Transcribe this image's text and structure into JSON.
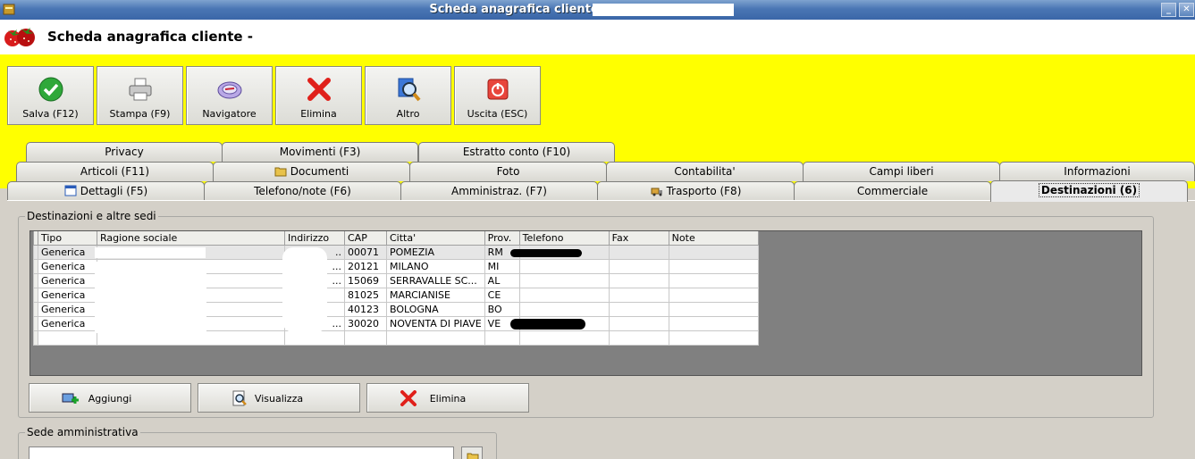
{
  "window": {
    "title": "Scheda anagrafica cliente -"
  },
  "header": {
    "title": "Scheda anagrafica cliente -"
  },
  "toolbar": [
    {
      "label": "Salva (F12)",
      "icon": "check-icon"
    },
    {
      "label": "Stampa (F9)",
      "icon": "printer-icon"
    },
    {
      "label": "Navigatore",
      "icon": "compass-icon"
    },
    {
      "label": "Elimina",
      "icon": "delete-x-icon"
    },
    {
      "label": "Altro",
      "icon": "magnifier-icon"
    },
    {
      "label": "Uscita (ESC)",
      "icon": "power-icon"
    }
  ],
  "tabs": {
    "row1": [
      "Privacy",
      "Movimenti (F3)",
      "Estratto conto (F10)"
    ],
    "row2": [
      "Articoli (F11)",
      "Documenti",
      "Foto",
      "Contabilita'",
      "Campi liberi",
      "Informazioni"
    ],
    "row3": [
      "Dettagli (F5)",
      "Telefono/note (F6)",
      "Amministraz. (F7)",
      "Trasporto (F8)",
      "Commerciale",
      "Destinazioni (6)"
    ]
  },
  "destinations": {
    "legend": "Destinazioni e altre sedi",
    "columns": [
      "Tipo",
      "Ragione sociale",
      "Indirizzo",
      "CAP",
      "Citta'",
      "Prov.",
      "Telefono",
      "Fax",
      "Note"
    ],
    "rows": [
      {
        "tipo": "Generica",
        "indirizzo": "..",
        "cap": "00071",
        "citta": "POMEZIA",
        "prov": "RM"
      },
      {
        "tipo": "Generica",
        "indirizzo": "...",
        "cap": "20121",
        "citta": "MILANO",
        "prov": "MI"
      },
      {
        "tipo": "Generica",
        "indirizzo": "...",
        "cap": "15069",
        "citta": "SERRAVALLE SC...",
        "prov": "AL"
      },
      {
        "tipo": "Generica",
        "indirizzo": "",
        "cap": "81025",
        "citta": "MARCIANISE",
        "prov": "CE"
      },
      {
        "tipo": "Generica",
        "indirizzo": "",
        "cap": "40123",
        "citta": "BOLOGNA",
        "prov": "BO"
      },
      {
        "tipo": "Generica",
        "indirizzo": "...",
        "cap": "30020",
        "citta": "NOVENTA DI PIAVE",
        "prov": "VE"
      }
    ],
    "buttons": [
      "Aggiungi",
      "Visualizza",
      "Elimina"
    ]
  },
  "sede": {
    "legend": "Sede amministrativa"
  },
  "colors": {
    "yellow": "#ffff00",
    "titlebar": "#4a76b4",
    "grid_bg": "#808080"
  }
}
